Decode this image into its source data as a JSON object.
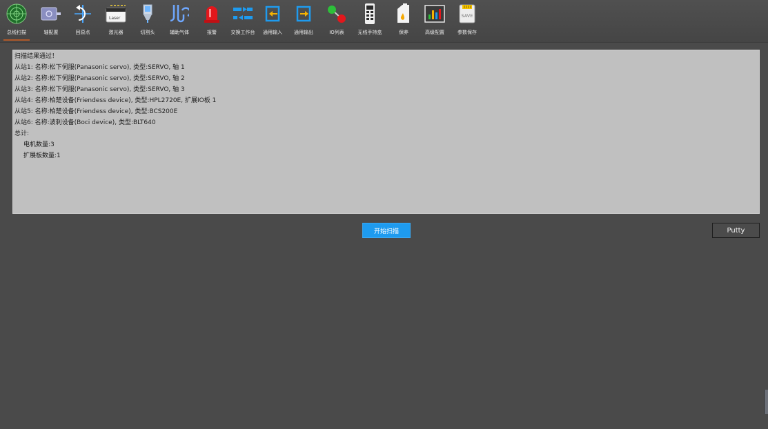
{
  "toolbar": {
    "items": [
      {
        "label": "总线扫描",
        "icon": "radar-icon"
      },
      {
        "label": "轴配置",
        "icon": "motor-icon"
      },
      {
        "label": "回原点",
        "icon": "return-origin-icon"
      },
      {
        "label": "激光器",
        "icon": "laser-icon",
        "icon_text": "Laser"
      },
      {
        "label": "切割头",
        "icon": "cutting-head-icon"
      },
      {
        "label": "辅助气体",
        "icon": "gas-icon"
      },
      {
        "label": "报警",
        "icon": "alarm-light-icon"
      },
      {
        "label": "交换工作台",
        "icon": "exchange-table-icon"
      },
      {
        "label": "通用输入",
        "icon": "input-icon"
      },
      {
        "label": "通用输出",
        "icon": "output-icon"
      },
      {
        "label": "IO列表",
        "icon": "io-list-icon"
      },
      {
        "label": "无线手持盒",
        "icon": "remote-icon"
      },
      {
        "label": "保养",
        "icon": "maintenance-icon"
      },
      {
        "label": "高级配置",
        "icon": "advanced-config-icon"
      },
      {
        "label": "参数保存",
        "icon": "save-card-icon",
        "icon_text": "SAVE"
      }
    ]
  },
  "log": {
    "lines": [
      "扫描结果通过！",
      "从站1: 名称:松下伺服(Panasonic servo), 类型:SERVO, 轴 1",
      "从站2: 名称:松下伺服(Panasonic servo), 类型:SERVO, 轴 2",
      "从站3: 名称:松下伺服(Panasonic servo), 类型:SERVO, 轴 3",
      "从站4: 名称:柏楚设备(Friendess device), 类型:HPL2720E, 扩展IO板 1",
      "从站5: 名称:柏楚设备(Friendess device), 类型:BCS200E",
      "从站6: 名称:波刺设备(Boci device), 类型:BLT640",
      "总计:",
      "电机数量:3",
      "扩展板数量:1"
    ]
  },
  "buttons": {
    "scan": "开始扫描",
    "putty": "Putty"
  },
  "colors": {
    "background": "#4a4a4a",
    "panel": "#c0c0c0",
    "accent": "#1e9bef",
    "active_underline": "#b05a2a"
  }
}
